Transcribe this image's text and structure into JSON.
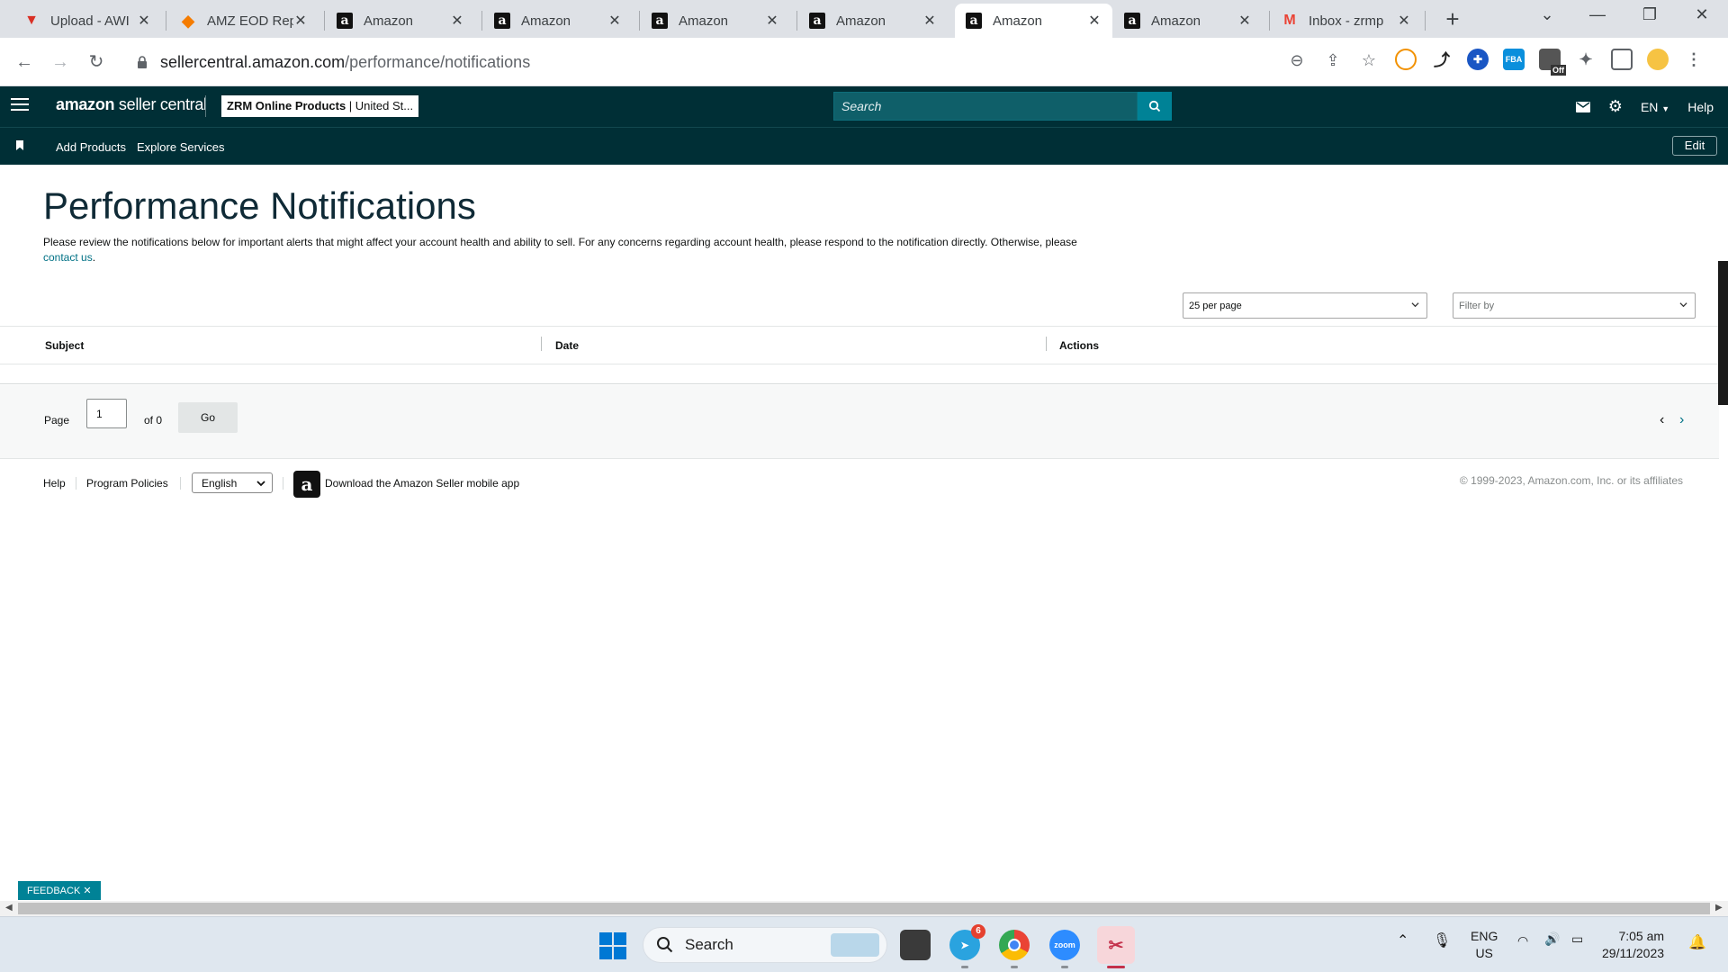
{
  "browser": {
    "tabs": [
      {
        "title": "Upload - AWI",
        "icon": "awi"
      },
      {
        "title": "AMZ EOD Rep",
        "icon": "eod"
      },
      {
        "title": "Amazon",
        "icon": "amz"
      },
      {
        "title": "Amazon",
        "icon": "amz"
      },
      {
        "title": "Amazon",
        "icon": "amz"
      },
      {
        "title": "Amazon",
        "icon": "amz"
      },
      {
        "title": "Amazon",
        "icon": "amz",
        "active": true
      },
      {
        "title": "Amazon",
        "icon": "amz"
      },
      {
        "title": "Inbox - zrmp",
        "icon": "gmail"
      }
    ],
    "url_host": "sellercentral.amazon.com",
    "url_path": "/performance/notifications",
    "extension_badge": "Off",
    "fba_label": "FBA"
  },
  "header": {
    "logo_bold": "amazon",
    "logo_rest": " seller central",
    "account_name": "ZRM Online Products",
    "account_market": "United St...",
    "search_placeholder": "Search",
    "language": "EN",
    "help": "Help"
  },
  "subnav": {
    "links": [
      "Add Products",
      "Explore Services"
    ],
    "edit": "Edit"
  },
  "page": {
    "title": "Performance Notifications",
    "description": "Please review the notifications below for important alerts that might affect your account health and ability to sell. For any concerns regarding account health, please respond to the notification directly. Otherwise, please",
    "contact_link": "contact us",
    "per_page": "25 per page",
    "filter_placeholder": "Filter by",
    "columns": [
      "Subject",
      "Date",
      "Actions"
    ],
    "pager": {
      "page_label": "Page",
      "page_value": "1",
      "of_label": "of 0",
      "go": "Go"
    }
  },
  "footer": {
    "help": "Help",
    "program_policies": "Program Policies",
    "language": "English",
    "app_download": "Download the Amazon Seller mobile app",
    "copyright": "© 1999-2023, Amazon.com, Inc. or its affiliates"
  },
  "feedback": "FEEDBACK",
  "taskbar": {
    "search": "Search",
    "telegram_badge": "6",
    "zoom_label": "zoom",
    "lang_top": "ENG",
    "lang_bottom": "US",
    "time": "7:05 am",
    "date": "29/11/2023"
  },
  "colors": {
    "header_bg": "#002f36",
    "search_btn": "#008296",
    "link": "#007185"
  }
}
